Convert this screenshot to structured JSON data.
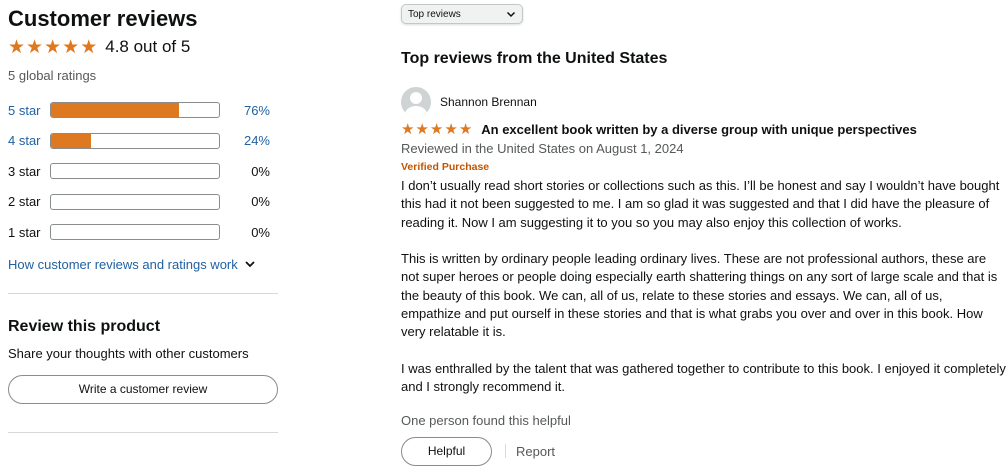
{
  "left": {
    "title": "Customer reviews",
    "rating_text": "4.8 out of 5",
    "global_ratings": "5 global ratings",
    "stars_filled": 5,
    "histogram": [
      {
        "label": "5 star",
        "pct_text": "76%",
        "pct": 76,
        "link": true
      },
      {
        "label": "4 star",
        "pct_text": "24%",
        "pct": 24,
        "link": true
      },
      {
        "label": "3 star",
        "pct_text": "0%",
        "pct": 0,
        "link": false
      },
      {
        "label": "2 star",
        "pct_text": "0%",
        "pct": 0,
        "link": false
      },
      {
        "label": "1 star",
        "pct_text": "0%",
        "pct": 0,
        "link": false
      }
    ],
    "how_link": "How customer reviews and ratings work",
    "review_product_title": "Review this product",
    "share_text": "Share your thoughts with other customers",
    "write_button": "Write a customer review"
  },
  "right": {
    "sort_selected": "Top reviews",
    "section_title": "Top reviews from the United States",
    "review": {
      "reviewer": "Shannon Brennan",
      "stars": 5,
      "headline": "An excellent book written by a diverse group with unique perspectives",
      "meta": "Reviewed in the United States on August 1, 2024",
      "verified": "Verified Purchase",
      "paragraphs": [
        "I don’t usually read short stories or collections such as this. I’ll be honest and say I wouldn’t have bought this had it not been suggested to me. I am so glad it was suggested and that I did have the pleasure of reading it. Now I am suggesting it to you so you may also enjoy this collection of works.",
        "This is written by ordinary people leading ordinary lives. These are not professional authors, these are not super heroes or people doing especially earth shattering things on any sort of large scale and that is the beauty of this book. We can, all of us, relate to these stories and essays. We can, all of us, empathize and put ourself in these stories and that is what grabs you over and over in this book. How very relatable it is.",
        "I was enthralled by the talent that was gathered together to contribute to this book. I enjoyed it completely and I strongly recommend it."
      ],
      "helpful_count": "One person found this helpful",
      "helpful_button": "Helpful",
      "report_link": "Report"
    }
  },
  "colors": {
    "star": "#de7921",
    "link": "#2162a1",
    "verified": "#c45500",
    "muted": "#565959"
  }
}
